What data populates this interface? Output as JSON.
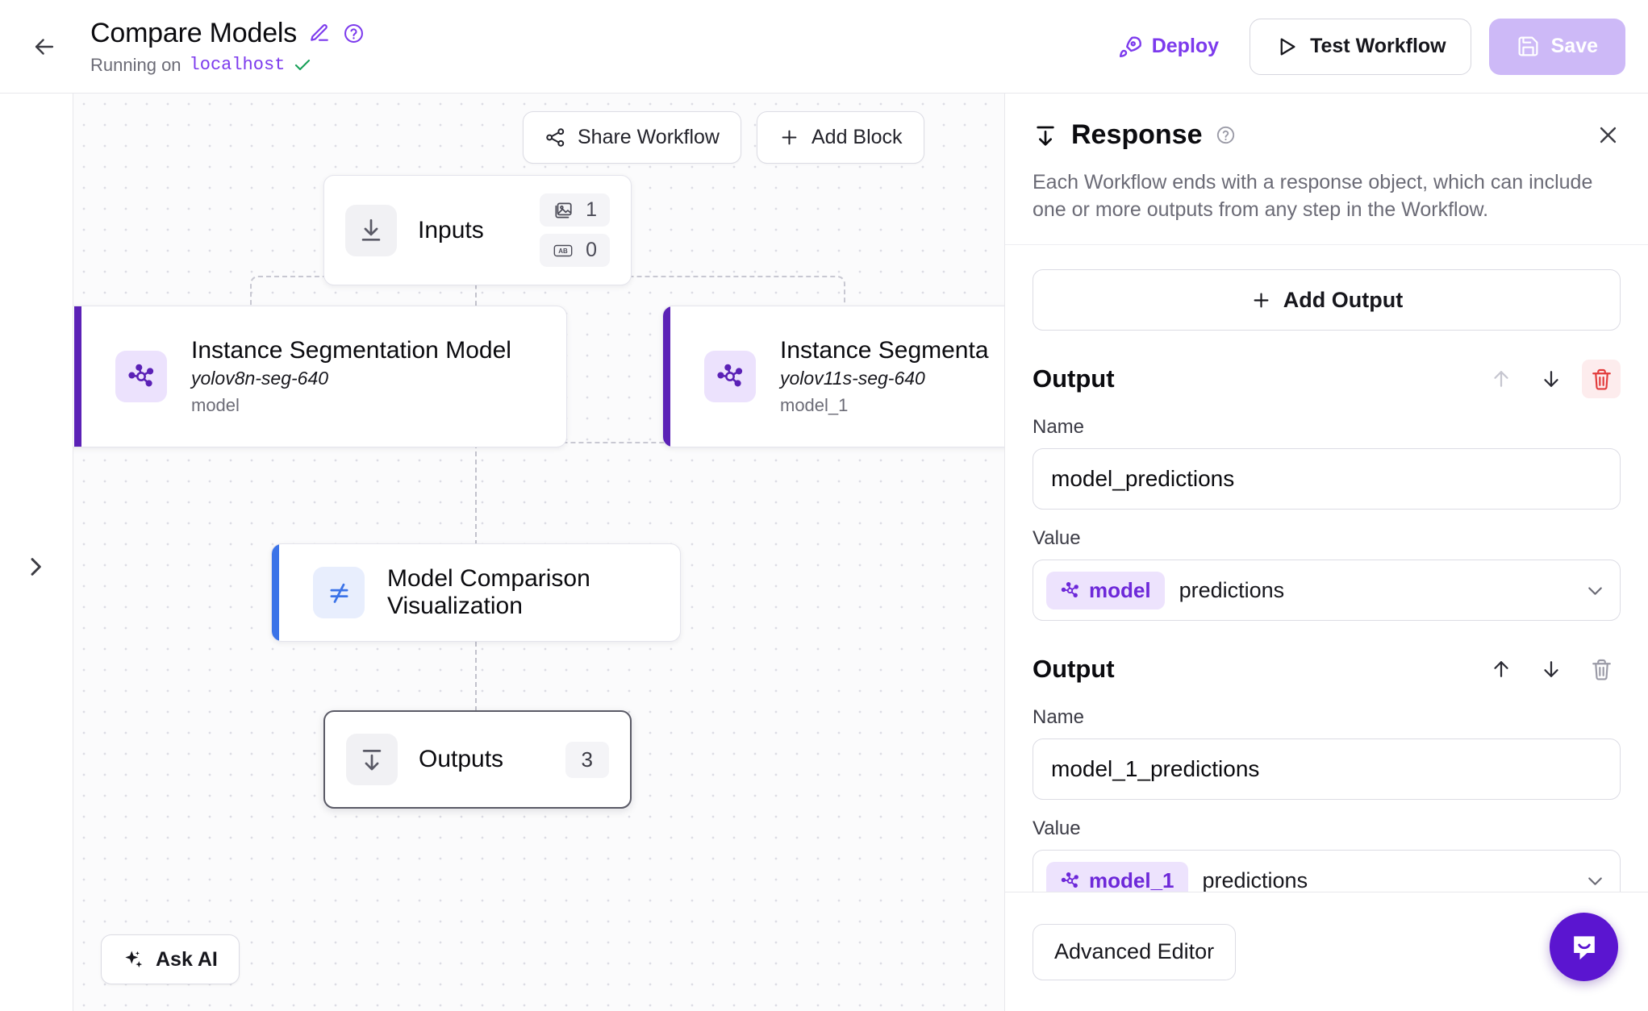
{
  "header": {
    "back_icon": "arrow-left-icon",
    "title": "Compare Models",
    "edit_icon": "pencil-icon",
    "help_icon": "question-circle-icon",
    "status_prefix": "Running on",
    "host": "localhost",
    "status_check_icon": "check-icon",
    "deploy_label": "Deploy",
    "deploy_icon": "rocket-icon",
    "test_label": "Test Workflow",
    "test_icon": "play-icon",
    "save_label": "Save",
    "save_icon": "floppy-disk-icon",
    "accent_purple": "#7c3aed",
    "save_bg": "#cdb9f7"
  },
  "left_rail": {
    "expand_icon": "chevron-right-icon"
  },
  "canvas": {
    "toolbar": {
      "share_label": "Share Workflow",
      "share_icon": "share-nodes-icon",
      "add_block_label": "Add Block",
      "add_block_icon": "plus-icon"
    },
    "ask_ai": {
      "label": "Ask AI",
      "icon": "sparkles-icon"
    },
    "nodes": {
      "inputs": {
        "title": "Inputs",
        "icon": "download-arrow-icon",
        "badges": [
          {
            "icon": "image-icon",
            "count": "1"
          },
          {
            "icon": "ab-text-icon",
            "count": "0"
          }
        ]
      },
      "model_a": {
        "title": "Instance Segmentation Model",
        "subtitle": "yolov8n-seg-640",
        "id": "model",
        "icon": "model-graph-icon",
        "accent": "#5b21b6"
      },
      "model_b": {
        "title": "Instance Segmenta",
        "subtitle": "yolov11s-seg-640",
        "id": "model_1",
        "icon": "model-graph-icon",
        "accent": "#5b21b6"
      },
      "comparison": {
        "title": "Model Comparison Visualization",
        "icon": "not-equal-icon",
        "accent": "#3b73e8"
      },
      "outputs": {
        "title": "Outputs",
        "icon": "upload-arrow-down-icon",
        "count": "3"
      }
    }
  },
  "panel": {
    "icon": "response-arrow-icon",
    "title": "Response",
    "help_icon": "question-circle-icon",
    "close_icon": "close-icon",
    "description": "Each Workflow ends with a response object, which can include one or more outputs from any step in the Workflow.",
    "add_output_label": "Add Output",
    "add_output_icon": "plus-icon",
    "outputs": [
      {
        "section_label": "Output",
        "move_up_icon": "arrow-up-icon",
        "move_down_icon": "arrow-down-icon",
        "delete_icon": "trash-icon",
        "move_up_enabled": false,
        "delete_active": true,
        "name_label": "Name",
        "name_value": "model_predictions",
        "value_label": "Value",
        "value_chip": "model",
        "value_chip_icon": "model-graph-icon",
        "value_field": "predictions",
        "chevron_icon": "chevron-down-icon"
      },
      {
        "section_label": "Output",
        "move_up_icon": "arrow-up-icon",
        "move_down_icon": "arrow-down-icon",
        "delete_icon": "trash-icon",
        "move_up_enabled": true,
        "delete_active": false,
        "name_label": "Name",
        "name_value": "model_1_predictions",
        "value_label": "Value",
        "value_chip": "model_1",
        "value_chip_icon": "model-graph-icon",
        "value_field": "predictions",
        "chevron_icon": "chevron-down-icon"
      }
    ],
    "footer": {
      "advanced_editor_label": "Advanced Editor"
    }
  },
  "chat_widget": {
    "icon": "chat-bubble-icon",
    "color": "#5b15d0"
  }
}
